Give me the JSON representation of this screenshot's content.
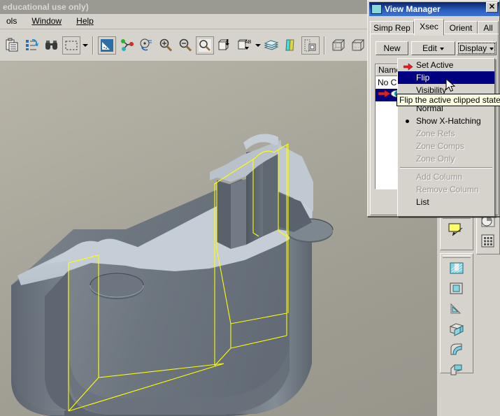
{
  "window": {
    "title": "educational use only)",
    "title_state": "inactive"
  },
  "menubar": {
    "items": [
      {
        "label": "ols",
        "name": "menu-tools"
      },
      {
        "label": "Window",
        "name": "menu-window"
      },
      {
        "label": "Help",
        "name": "menu-help"
      }
    ]
  },
  "toolbar": {
    "groups": [
      {
        "buttons": [
          {
            "name": "clipboard-icon",
            "title": "Clipboard"
          },
          {
            "name": "regenerate-icon",
            "title": "Regenerate"
          },
          {
            "name": "find-icon",
            "title": "Find"
          },
          {
            "name": "selection-box-icon",
            "title": "Selection Filter"
          }
        ]
      },
      {
        "buttons": [
          {
            "name": "shading-icon",
            "title": "Shading"
          },
          {
            "name": "datum-points-icon",
            "title": "Datum Points"
          },
          {
            "name": "spin-center-icon",
            "title": "Spin Center"
          },
          {
            "name": "zoom-in-icon",
            "title": "Zoom In"
          },
          {
            "name": "zoom-out-icon",
            "title": "Zoom Out"
          },
          {
            "name": "refit-icon",
            "title": "Refit"
          },
          {
            "name": "layer-icon",
            "title": "Layers"
          },
          {
            "name": "annotation-ab-icon",
            "title": "Annotations"
          },
          {
            "name": "stack-icon",
            "title": "Stack"
          },
          {
            "name": "colors-icon",
            "title": "Colors"
          },
          {
            "name": "saved-views-icon",
            "title": "Saved Views"
          }
        ]
      },
      {
        "buttons": [
          {
            "name": "wireframe-cube-icon",
            "title": "Wireframe"
          },
          {
            "name": "hidden-line-cube-icon",
            "title": "Hidden Line"
          },
          {
            "name": "no-hidden-cube-icon",
            "title": "No Hidden"
          },
          {
            "name": "shaded-cube-icon",
            "title": "Shaded"
          }
        ]
      }
    ]
  },
  "view_manager": {
    "title": "View Manager",
    "close_label": "✕",
    "tabs": [
      {
        "label": "Simp Rep",
        "active": false
      },
      {
        "label": "Xsec",
        "active": true
      },
      {
        "label": "Orient",
        "active": false
      },
      {
        "label": "All",
        "active": false
      }
    ],
    "buttons": [
      {
        "label": "New",
        "name": "new-button",
        "caret": false,
        "focused": false
      },
      {
        "label": "Edit",
        "name": "edit-button",
        "caret": true,
        "focused": false
      },
      {
        "label": "Display",
        "name": "display-button",
        "caret": true,
        "focused": true
      }
    ],
    "list": {
      "header": "Names",
      "rows": [
        {
          "label": "No Cro",
          "selected": false,
          "icon": ""
        },
        {
          "label": "",
          "selected": true,
          "icon": "active-xsec-icon"
        }
      ]
    }
  },
  "dropdown_menu": {
    "name": "display-dropdown-menu",
    "items": [
      {
        "label": "Set Active",
        "state": "normal",
        "icon": "red-arrow-icon"
      },
      {
        "label": "Flip",
        "state": "highlighted",
        "icon": ""
      },
      {
        "label": "Visibility",
        "state": "normal",
        "icon": "",
        "obscured": true
      },
      {
        "separator": true
      },
      {
        "label": "Normal",
        "state": "normal",
        "icon": ""
      },
      {
        "label": "Show X-Hatching",
        "state": "normal",
        "icon": "radio-bullet"
      },
      {
        "label": "Zone Refs",
        "state": "disabled",
        "icon": ""
      },
      {
        "label": "Zone Comps",
        "state": "disabled",
        "icon": ""
      },
      {
        "label": "Zone Only",
        "state": "disabled",
        "icon": ""
      },
      {
        "separator": true
      },
      {
        "label": "Add Column",
        "state": "disabled",
        "icon": ""
      },
      {
        "label": "Remove Column",
        "state": "disabled",
        "icon": ""
      },
      {
        "label": "List",
        "state": "normal",
        "icon": ""
      }
    ]
  },
  "tooltip": {
    "text": "Flip the active clipped state"
  },
  "right_dock": {
    "panels": [
      {
        "name": "xsec-tools-panel",
        "buttons": [
          {
            "name": "create-xsec-icon",
            "title": "Create Cross Section"
          }
        ]
      },
      {
        "name": "feature-tools-panel",
        "buttons": [
          {
            "name": "slot-feature-icon",
            "title": "Slot"
          },
          {
            "name": "shell-feature-icon",
            "title": "Shell"
          },
          {
            "name": "draft-feature-icon",
            "title": "Draft"
          },
          {
            "name": "rib-feature-icon",
            "title": "Rib"
          },
          {
            "name": "round-feature-icon",
            "title": "Round"
          },
          {
            "name": "chamfer-feature-icon",
            "title": "Chamfer"
          }
        ]
      },
      {
        "name": "analysis-tools-panel",
        "buttons": [
          {
            "name": "pie-analysis-icon",
            "title": "Mass Properties"
          },
          {
            "name": "grid-table-icon",
            "title": "Table"
          }
        ]
      }
    ]
  },
  "viewport": {
    "name": "model-viewport",
    "model_name": "bracket-part",
    "xsec_line_color": "#ffff00",
    "face_light": "#c3ccd4",
    "face_mid": "#6e7780",
    "face_dark": "#5a636c",
    "background_top": "#b8b5a8",
    "background_bottom": "#97958b"
  }
}
